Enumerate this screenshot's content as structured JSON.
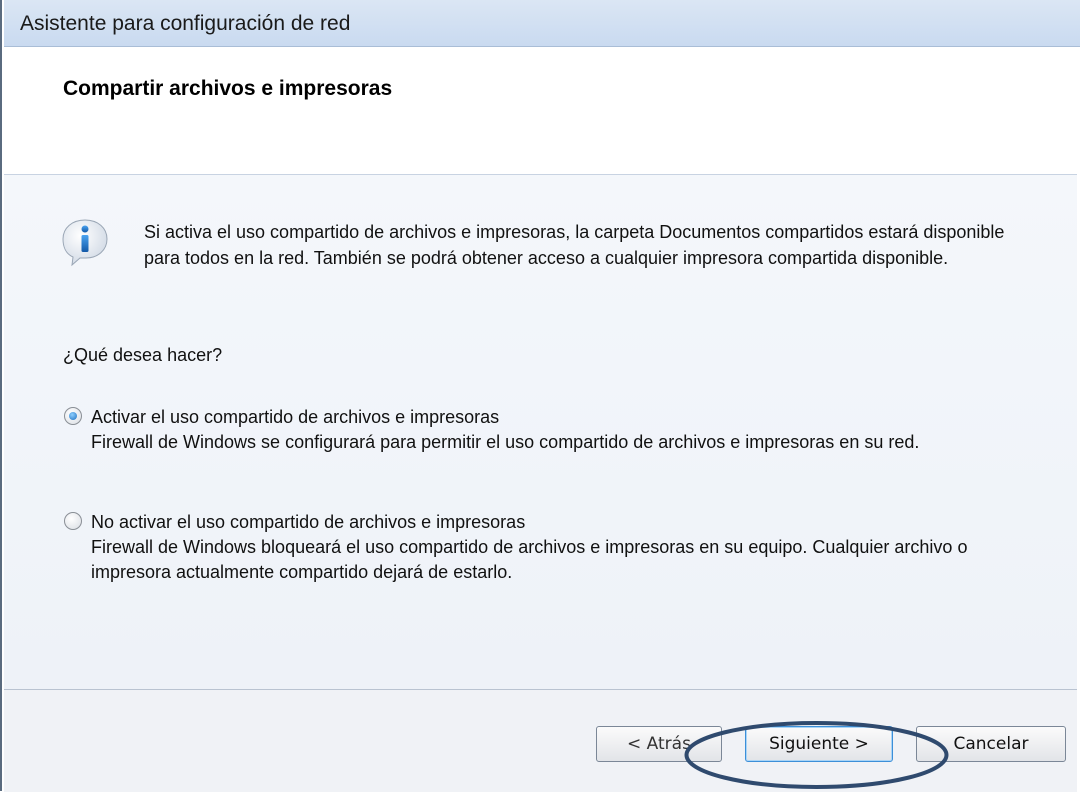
{
  "window": {
    "title": "Asistente para configuración de red"
  },
  "header": {
    "heading": "Compartir archivos e impresoras"
  },
  "info": {
    "icon": "info-icon",
    "text": "Si activa el uso compartido de archivos e impresoras, la carpeta Documentos compartidos estará disponible para todos en la red. También se podrá obtener acceso a cualquier impresora compartida disponible."
  },
  "question": "¿Qué desea hacer?",
  "options": [
    {
      "label": "Activar el uso compartido de archivos e impresoras",
      "description": "Firewall de Windows se configurará para permitir el uso compartido de archivos e impresoras en su red.",
      "selected": true
    },
    {
      "label": "No activar el uso compartido de archivos e impresoras",
      "description": "Firewall de Windows bloqueará el uso compartido de archivos e impresoras en su equipo. Cualquier archivo o impresora actualmente compartido dejará de estarlo.",
      "selected": false
    }
  ],
  "buttons": {
    "back": "< Atrás",
    "next": "Siguiente >",
    "cancel": "Cancelar"
  },
  "colors": {
    "highlight_ellipse": "#2f4a6e",
    "title_bar": "#d3e1f2"
  }
}
